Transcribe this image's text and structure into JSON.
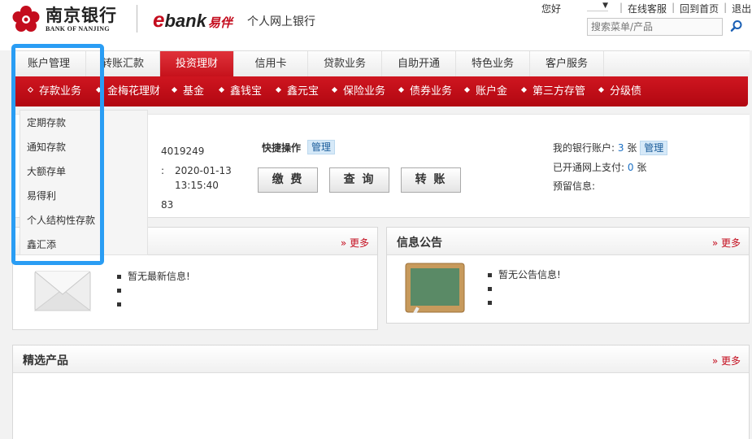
{
  "header": {
    "bank_name_cn": "南京银行",
    "bank_name_en": "BANK OF NANJING",
    "ebank_logo": "bank",
    "ebank_cn": "易伴",
    "site_title": "个人网上银行",
    "greeting": "您好",
    "links": [
      "在线客服",
      "回到首页",
      "退出"
    ],
    "search_placeholder": "搜索菜单/产品"
  },
  "main_nav": {
    "items": [
      "账户管理",
      "转账汇款",
      "投资理财",
      "信用卡",
      "贷款业务",
      "自助开通",
      "特色业务",
      "客户服务"
    ],
    "active": "投资理财"
  },
  "sub_nav": {
    "items": [
      "存款业务",
      "金梅花理财",
      "基金",
      "鑫钱宝",
      "鑫元宝",
      "保险业务",
      "债券业务",
      "账户金",
      "第三方存管",
      "分级债"
    ],
    "selected": "存款业务"
  },
  "dropdown": {
    "items": [
      "定期存款",
      "通知存款",
      "大额存单",
      "易得利",
      "个人结构性存款",
      "鑫汇添"
    ]
  },
  "account_info": {
    "account_partial": "4019249",
    "login_date": "2020-01-13",
    "login_time": "13:15:40",
    "account_tail": "83",
    "colon": ":"
  },
  "quick": {
    "label": "快捷操作",
    "manage": "管理",
    "buttons": [
      "缴 费",
      "查 询",
      "转 账"
    ]
  },
  "my_accounts": {
    "bank_accounts_label": "我的银行账户:",
    "bank_accounts_count": "3",
    "unit": "张",
    "manage": "管理",
    "online_pay_label": "已开通网上支付:",
    "online_pay_count": "0",
    "reserved_label": "预留信息:"
  },
  "boxes": {
    "news": {
      "more": "» 更多",
      "first": "暂无最新信息!"
    },
    "notice": {
      "title": "信息公告",
      "more": "» 更多",
      "first": "暂无公告信息!"
    },
    "products": {
      "title": "精选产品",
      "more": "» 更多"
    }
  },
  "colors": {
    "brand_red": "#c40d1e",
    "highlight_blue": "#2a9df4",
    "link_blue": "#1a6fc4"
  }
}
